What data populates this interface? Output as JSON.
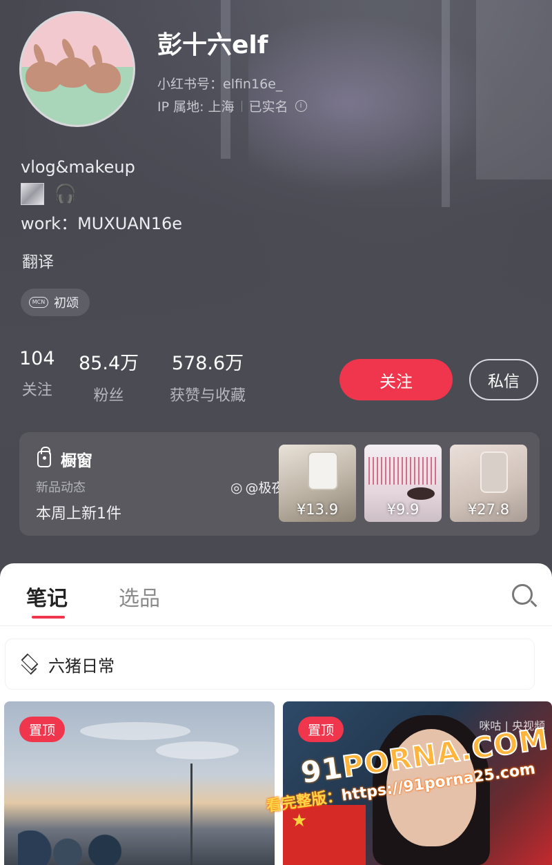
{
  "profile": {
    "username": "彭十六elf",
    "account_id": "小红书号：elfin16e_",
    "ip_location": "IP 属地: 上海",
    "verified": "已实名",
    "bio_line1": "vlog&makeup",
    "bio_line3": "work：MUXUAN16e",
    "translate": "翻译",
    "mcn_label": "初颂",
    "mcn_icon_text": "MCN"
  },
  "stats": [
    {
      "value": "104",
      "label": "关注"
    },
    {
      "value": "85.4万",
      "label": "粉丝"
    },
    {
      "value": "578.6万",
      "label": "获赞与收藏"
    }
  ],
  "actions": {
    "follow": "关注",
    "message": "私信"
  },
  "shop": {
    "title": "橱窗",
    "subtitle": "新品动态",
    "new_items": "本周上新1件",
    "weibo_handle": "@极夜同奏",
    "products": [
      {
        "price": "¥13.9"
      },
      {
        "price": "¥9.9"
      },
      {
        "price": "¥27.8"
      }
    ]
  },
  "tabs": [
    {
      "label": "笔记",
      "active": true
    },
    {
      "label": "选品",
      "active": false
    }
  ],
  "collection": {
    "title": "六猪日常"
  },
  "posts": [
    {
      "badge": "置顶"
    },
    {
      "badge": "置顶",
      "broadcaster": "咪咕 | 央视频"
    }
  ],
  "watermark": {
    "logo_prefix": "91",
    "logo": "PORNA.COM",
    "url_label": "看完整版：",
    "url": "https://91porna25.com"
  },
  "colors": {
    "accent": "#f0364c",
    "header_bg": "#4a4a52",
    "shop_bg": "#59595f"
  },
  "icons": [
    "info-icon",
    "square-icon",
    "headphone-icon",
    "mcn-icon",
    "bag-icon",
    "weibo-icon",
    "search-icon",
    "layers-icon"
  ]
}
